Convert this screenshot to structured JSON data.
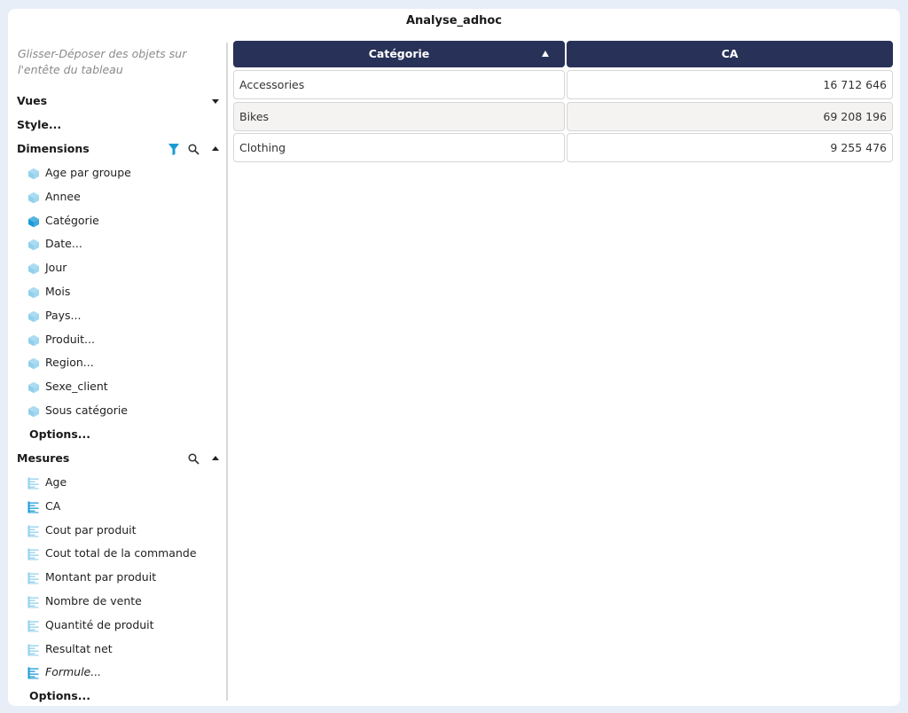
{
  "title": "Analyse_adhoc",
  "sidebar": {
    "hint": "Glisser-Déposer des objets sur l'entête du tableau",
    "vues_label": "Vues",
    "style_label": "Style...",
    "dimensions": {
      "label": "Dimensions",
      "items": [
        {
          "label": "Age par groupe",
          "active": false
        },
        {
          "label": "Annee",
          "active": false
        },
        {
          "label": "Catégorie",
          "active": true
        },
        {
          "label": "Date...",
          "active": false
        },
        {
          "label": "Jour",
          "active": false
        },
        {
          "label": "Mois",
          "active": false
        },
        {
          "label": "Pays...",
          "active": false
        },
        {
          "label": "Produit...",
          "active": false
        },
        {
          "label": "Region...",
          "active": false
        },
        {
          "label": "Sexe_client",
          "active": false
        },
        {
          "label": "Sous catégorie",
          "active": false
        }
      ],
      "options_label": "Options..."
    },
    "mesures": {
      "label": "Mesures",
      "items": [
        {
          "label": "Age",
          "active": false
        },
        {
          "label": "CA",
          "active": true
        },
        {
          "label": "Cout par produit",
          "active": false
        },
        {
          "label": "Cout total de la commande",
          "active": false
        },
        {
          "label": "Montant par produit",
          "active": false
        },
        {
          "label": "Nombre de vente",
          "active": false
        },
        {
          "label": "Quantité de produit",
          "active": false
        },
        {
          "label": "Resultat net",
          "active": false
        },
        {
          "label": "Formule...",
          "active": true
        }
      ],
      "options_label": "Options..."
    }
  },
  "table": {
    "columns": [
      "Catégorie",
      "CA"
    ],
    "rows": [
      [
        "Accessories",
        "16 712 646"
      ],
      [
        "Bikes",
        "69 208 196"
      ],
      [
        "Clothing",
        "9 255 476"
      ]
    ]
  },
  "colors": {
    "header_bg": "#283157",
    "icon_light": "#8fd0ec",
    "icon_active": "#1a9bd7",
    "filter_icon": "#1a9bd7"
  },
  "icons": {
    "dimension": "cube-icon",
    "measure": "ruler-icon",
    "filter": "filter-icon",
    "search": "search-icon"
  }
}
